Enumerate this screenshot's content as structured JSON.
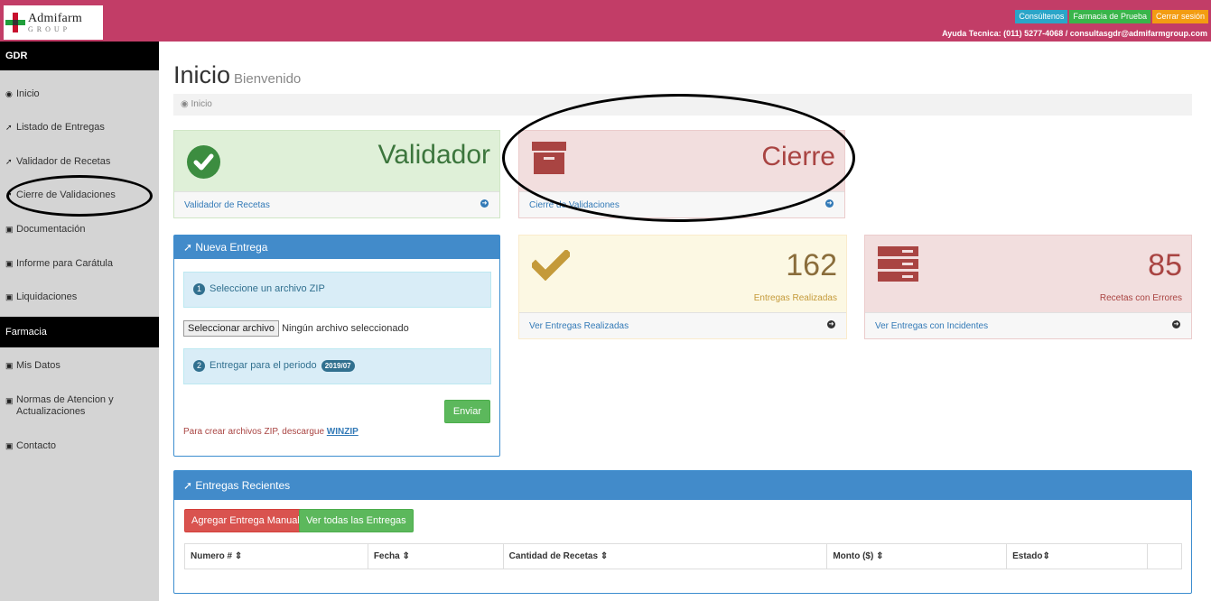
{
  "header": {
    "logo_title": "Admifarm",
    "logo_sub": "GROUP",
    "buttons": {
      "consultas": "Consúltenos",
      "farmacia": "Farmacia de Prueba",
      "logout": "Cerrar sesión"
    },
    "help": "Ayuda Tecnica: (011) 5277-4068 / consultasgdr@admifarmgroup.com"
  },
  "sidebar": {
    "section1": "GDR",
    "items1": [
      "Inicio",
      "Listado de Entregas",
      "Validador de Recetas",
      "Cierre de Validaciones",
      "Documentación",
      "Informe para Carátula",
      "Liquidaciones"
    ],
    "section2": "Farmacia",
    "items2": [
      "Mis Datos",
      "Normas de Atencion y Actualizaciones",
      "Contacto"
    ]
  },
  "page": {
    "title": "Inicio",
    "subtitle": "Bienvenido",
    "breadcrumb": "Inicio"
  },
  "tiles": {
    "validador": {
      "title": "Validador",
      "link": "Validador de Recetas"
    },
    "cierre": {
      "title": "Cierre",
      "link": "Cierre de Validaciones"
    },
    "entregas": {
      "count": "162",
      "label": "Entregas Realizadas",
      "link": "Ver Entregas Realizadas"
    },
    "errores": {
      "count": "85",
      "label": "Recetas con Errores",
      "link": "Ver Entregas con Incidentes"
    }
  },
  "nueva_entrega": {
    "title": "Nueva Entrega",
    "step1_num": "1",
    "step1": "Seleccione un archivo ZIP",
    "file_button": "Seleccionar archivo",
    "file_status": "Ningún archivo seleccionado",
    "step2_num": "2",
    "step2": "Entregar para el periodo",
    "periodo": "2019/07",
    "send": "Enviar",
    "zip_note": "Para crear archivos ZIP, descargue",
    "zip_link": "WINZIP"
  },
  "recientes": {
    "title": "Entregas Recientes",
    "btn_manual": "Agregar Entrega Manual",
    "btn_all": "Ver todas las Entregas",
    "columns": [
      "Numero # ⇕",
      "Fecha ⇕",
      "Cantidad de Recetas ⇕",
      "Monto ($) ⇕",
      "Estado⇕"
    ]
  },
  "colors": {
    "topbar": "#c23d67",
    "success": "#39b54a",
    "danger": "#a94442",
    "warning": "#c49a3a",
    "primary": "#428bca"
  }
}
